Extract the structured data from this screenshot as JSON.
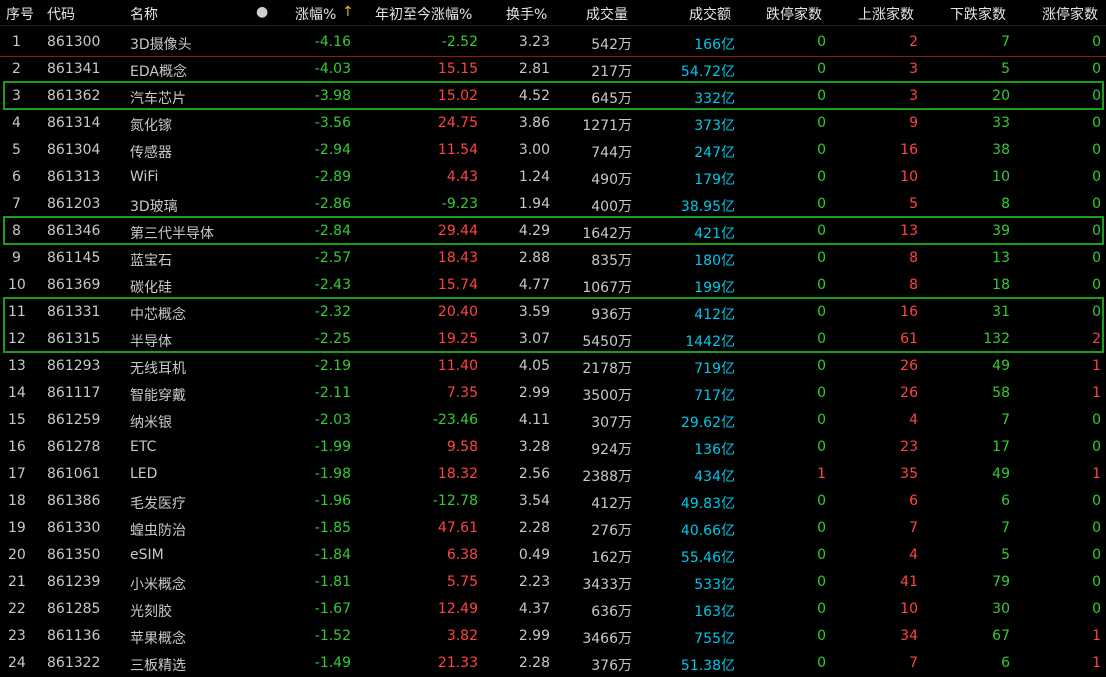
{
  "colors": {
    "up": "#ff4444",
    "down": "#33cc33",
    "amount": "#00c8e8",
    "text": "#c8c8c8",
    "frame": "#1a9e1a"
  },
  "header": {
    "seq": "序号",
    "code": "代码",
    "name": "名称",
    "dot": "●",
    "chg": "涨幅%",
    "sort_arrow": "↑",
    "ytd": "年初至今涨幅%",
    "turnover": "换手%",
    "volume": "成交量",
    "amount": "成交额",
    "limit_down": "跌停家数",
    "up_count": "上涨家数",
    "down_count": "下跌家数",
    "limit_up": "涨停家数"
  },
  "rows": [
    {
      "seq": "1",
      "code": "861300",
      "name": "3D摄像头",
      "chg": "-4.16",
      "ytd": "-2.52",
      "turnover": "3.23",
      "volume": "542万",
      "amount": "166亿",
      "limit_down": "0",
      "up": "2",
      "down": "7",
      "limit_up": "0"
    },
    {
      "seq": "2",
      "code": "861341",
      "name": "EDA概念",
      "chg": "-4.03",
      "ytd": "15.15",
      "turnover": "2.81",
      "volume": "217万",
      "amount": "54.72亿",
      "limit_down": "0",
      "up": "3",
      "down": "5",
      "limit_up": "0"
    },
    {
      "seq": "3",
      "code": "861362",
      "name": "汽车芯片",
      "chg": "-3.98",
      "ytd": "15.02",
      "turnover": "4.52",
      "volume": "645万",
      "amount": "332亿",
      "limit_down": "0",
      "up": "3",
      "down": "20",
      "limit_up": "0"
    },
    {
      "seq": "4",
      "code": "861314",
      "name": "氮化镓",
      "chg": "-3.56",
      "ytd": "24.75",
      "turnover": "3.86",
      "volume": "1271万",
      "amount": "373亿",
      "limit_down": "0",
      "up": "9",
      "down": "33",
      "limit_up": "0"
    },
    {
      "seq": "5",
      "code": "861304",
      "name": "传感器",
      "chg": "-2.94",
      "ytd": "11.54",
      "turnover": "3.00",
      "volume": "744万",
      "amount": "247亿",
      "limit_down": "0",
      "up": "16",
      "down": "38",
      "limit_up": "0"
    },
    {
      "seq": "6",
      "code": "861313",
      "name": "WiFi",
      "chg": "-2.89",
      "ytd": "4.43",
      "turnover": "1.24",
      "volume": "490万",
      "amount": "179亿",
      "limit_down": "0",
      "up": "10",
      "down": "10",
      "limit_up": "0"
    },
    {
      "seq": "7",
      "code": "861203",
      "name": "3D玻璃",
      "chg": "-2.86",
      "ytd": "-9.23",
      "turnover": "1.94",
      "volume": "400万",
      "amount": "38.95亿",
      "limit_down": "0",
      "up": "5",
      "down": "8",
      "limit_up": "0"
    },
    {
      "seq": "8",
      "code": "861346",
      "name": "第三代半导体",
      "chg": "-2.84",
      "ytd": "29.44",
      "turnover": "4.29",
      "volume": "1642万",
      "amount": "421亿",
      "limit_down": "0",
      "up": "13",
      "down": "39",
      "limit_up": "0"
    },
    {
      "seq": "9",
      "code": "861145",
      "name": "蓝宝石",
      "chg": "-2.57",
      "ytd": "18.43",
      "turnover": "2.88",
      "volume": "835万",
      "amount": "180亿",
      "limit_down": "0",
      "up": "8",
      "down": "13",
      "limit_up": "0"
    },
    {
      "seq": "10",
      "code": "861369",
      "name": "碳化硅",
      "chg": "-2.43",
      "ytd": "15.74",
      "turnover": "4.77",
      "volume": "1067万",
      "amount": "199亿",
      "limit_down": "0",
      "up": "8",
      "down": "18",
      "limit_up": "0"
    },
    {
      "seq": "11",
      "code": "861331",
      "name": "中芯概念",
      "chg": "-2.32",
      "ytd": "20.40",
      "turnover": "3.59",
      "volume": "936万",
      "amount": "412亿",
      "limit_down": "0",
      "up": "16",
      "down": "31",
      "limit_up": "0"
    },
    {
      "seq": "12",
      "code": "861315",
      "name": "半导体",
      "chg": "-2.25",
      "ytd": "19.25",
      "turnover": "3.07",
      "volume": "5450万",
      "amount": "1442亿",
      "limit_down": "0",
      "up": "61",
      "down": "132",
      "limit_up": "2"
    },
    {
      "seq": "13",
      "code": "861293",
      "name": "无线耳机",
      "chg": "-2.19",
      "ytd": "11.40",
      "turnover": "4.05",
      "volume": "2178万",
      "amount": "719亿",
      "limit_down": "0",
      "up": "26",
      "down": "49",
      "limit_up": "1"
    },
    {
      "seq": "14",
      "code": "861117",
      "name": "智能穿戴",
      "chg": "-2.11",
      "ytd": "7.35",
      "turnover": "2.99",
      "volume": "3500万",
      "amount": "717亿",
      "limit_down": "0",
      "up": "26",
      "down": "58",
      "limit_up": "1"
    },
    {
      "seq": "15",
      "code": "861259",
      "name": "纳米银",
      "chg": "-2.03",
      "ytd": "-23.46",
      "turnover": "4.11",
      "volume": "307万",
      "amount": "29.62亿",
      "limit_down": "0",
      "up": "4",
      "down": "7",
      "limit_up": "0"
    },
    {
      "seq": "16",
      "code": "861278",
      "name": "ETC",
      "chg": "-1.99",
      "ytd": "9.58",
      "turnover": "3.28",
      "volume": "924万",
      "amount": "136亿",
      "limit_down": "0",
      "up": "23",
      "down": "17",
      "limit_up": "0"
    },
    {
      "seq": "17",
      "code": "861061",
      "name": "LED",
      "chg": "-1.98",
      "ytd": "18.32",
      "turnover": "2.56",
      "volume": "2388万",
      "amount": "434亿",
      "limit_down": "1",
      "up": "35",
      "down": "49",
      "limit_up": "1"
    },
    {
      "seq": "18",
      "code": "861386",
      "name": "毛发医疗",
      "chg": "-1.96",
      "ytd": "-12.78",
      "turnover": "3.54",
      "volume": "412万",
      "amount": "49.83亿",
      "limit_down": "0",
      "up": "6",
      "down": "6",
      "limit_up": "0"
    },
    {
      "seq": "19",
      "code": "861330",
      "name": "蝗虫防治",
      "chg": "-1.85",
      "ytd": "47.61",
      "turnover": "2.28",
      "volume": "276万",
      "amount": "40.66亿",
      "limit_down": "0",
      "up": "7",
      "down": "7",
      "limit_up": "0"
    },
    {
      "seq": "20",
      "code": "861350",
      "name": "eSIM",
      "chg": "-1.84",
      "ytd": "6.38",
      "turnover": "0.49",
      "volume": "162万",
      "amount": "55.46亿",
      "limit_down": "0",
      "up": "4",
      "down": "5",
      "limit_up": "0"
    },
    {
      "seq": "21",
      "code": "861239",
      "name": "小米概念",
      "chg": "-1.81",
      "ytd": "5.75",
      "turnover": "2.23",
      "volume": "3433万",
      "amount": "533亿",
      "limit_down": "0",
      "up": "41",
      "down": "79",
      "limit_up": "0"
    },
    {
      "seq": "22",
      "code": "861285",
      "name": "光刻胶",
      "chg": "-1.67",
      "ytd": "12.49",
      "turnover": "4.37",
      "volume": "636万",
      "amount": "163亿",
      "limit_down": "0",
      "up": "10",
      "down": "30",
      "limit_up": "0"
    },
    {
      "seq": "23",
      "code": "861136",
      "name": "苹果概念",
      "chg": "-1.52",
      "ytd": "3.82",
      "turnover": "2.99",
      "volume": "3466万",
      "amount": "755亿",
      "limit_down": "0",
      "up": "34",
      "down": "67",
      "limit_up": "1"
    },
    {
      "seq": "24",
      "code": "861322",
      "name": "三板精选",
      "chg": "-1.49",
      "ytd": "21.33",
      "turnover": "2.28",
      "volume": "376万",
      "amount": "51.38亿",
      "limit_down": "0",
      "up": "7",
      "down": "6",
      "limit_up": "1"
    }
  ],
  "highlighted_rows": [
    [
      3,
      3
    ],
    [
      8,
      8
    ],
    [
      11,
      12
    ]
  ]
}
